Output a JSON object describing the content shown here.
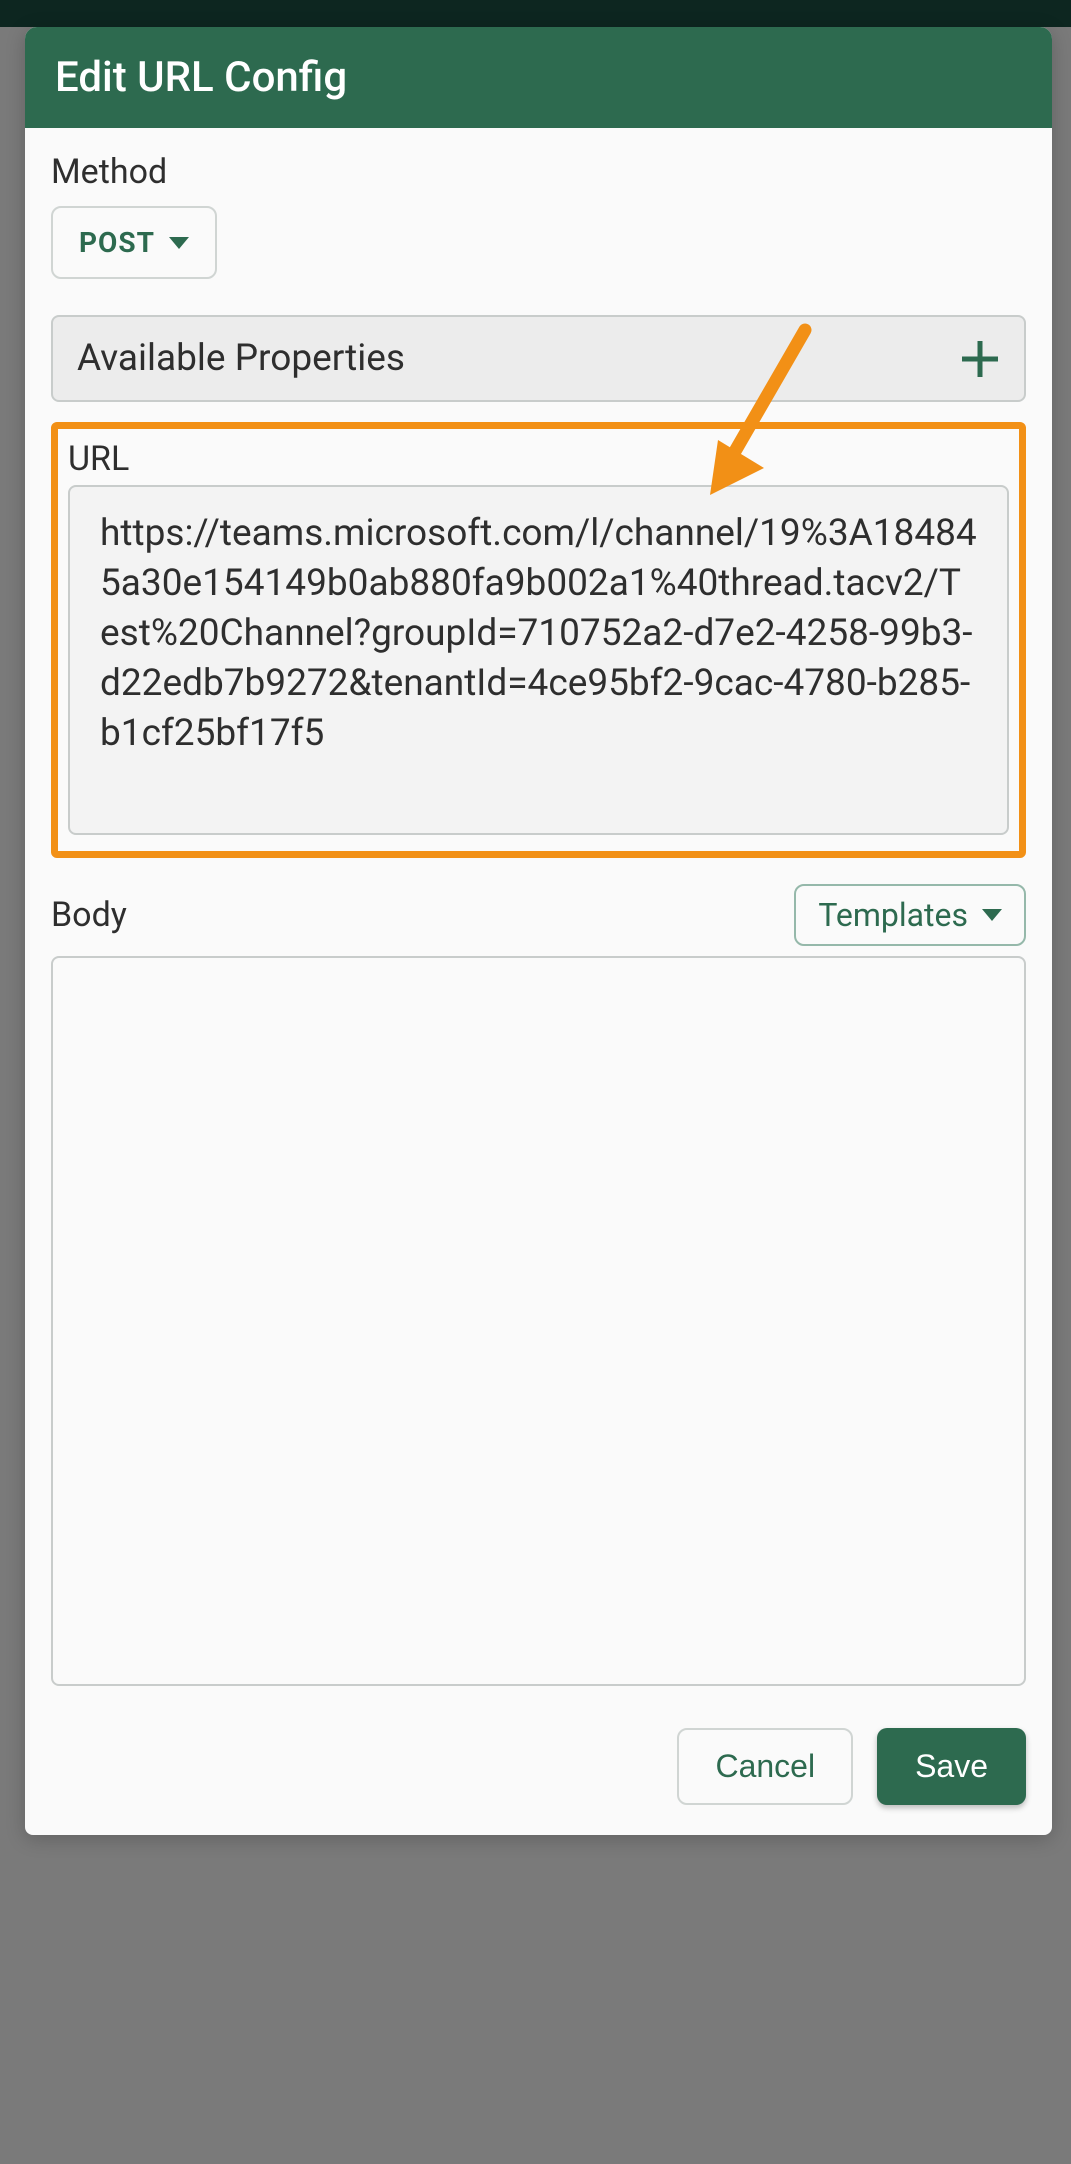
{
  "modal": {
    "title": "Edit URL Config"
  },
  "method": {
    "label": "Method",
    "value": "POST"
  },
  "availableProperties": {
    "label": "Available Properties"
  },
  "url": {
    "label": "URL",
    "value": "https://teams.microsoft.com/l/channel/19%3A184845a30e154149b0ab880fa9b002a1%40thread.tacv2/Test%20Channel?groupId=710752a2-d7e2-4258-99b3-d22edb7b9272&tenantId=4ce95bf2-9cac-4780-b285-b1cf25bf17f5"
  },
  "body": {
    "label": "Body",
    "templates_label": "Templates",
    "value": ""
  },
  "footer": {
    "cancel": "Cancel",
    "save": "Save"
  },
  "colors": {
    "primary": "#2d6a4f",
    "highlight": "#f29016"
  }
}
